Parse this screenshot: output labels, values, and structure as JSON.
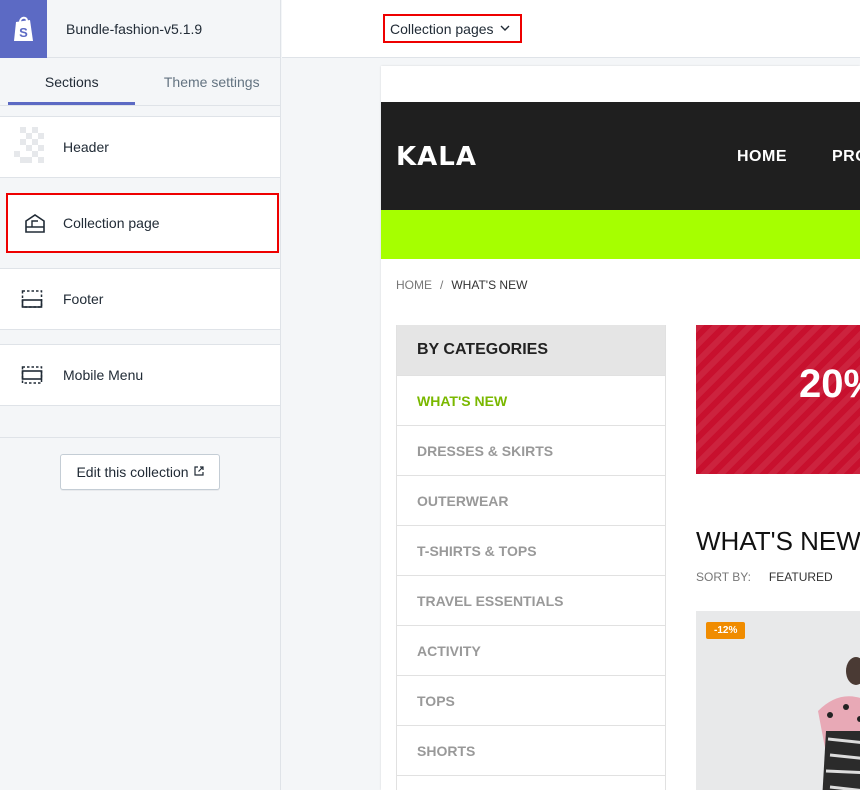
{
  "theme": {
    "name": "Bundle-fashion-v5.1.9",
    "logo_icon": "shopify-bag-icon",
    "accent": "#5c6ac4"
  },
  "tabs": {
    "sections": "Sections",
    "theme_settings": "Theme settings"
  },
  "sections": [
    {
      "label": "Header",
      "icon": "header-placeholder-icon"
    },
    {
      "label": "Collection page",
      "icon": "collection-template-icon",
      "highlighted": true
    },
    {
      "label": "Footer",
      "icon": "footer-layout-icon"
    },
    {
      "label": "Mobile Menu",
      "icon": "mobile-menu-layout-icon"
    }
  ],
  "edit_collection": {
    "label": "Edit this collection",
    "icon": "external-link-icon"
  },
  "page_selector": {
    "value": "Collection pages",
    "icon": "chevron-down-icon"
  },
  "store": {
    "logo": "KALA",
    "nav": [
      "HOME",
      "PRO"
    ],
    "colors": {
      "header_bg": "#1f1f1f",
      "banner": "#a6ff00",
      "active_category": "#7ab800",
      "promo": "#c8102e",
      "badge": "#f08c00"
    },
    "breadcrumb": {
      "home": "HOME",
      "separator": "/",
      "current": "WHAT'S NEW"
    },
    "categories": {
      "heading": "BY CATEGORIES",
      "items": [
        "WHAT'S NEW",
        "DRESSES & SKIRTS",
        "OUTERWEAR",
        "T-SHIRTS & TOPS",
        "TRAVEL ESSENTIALS",
        "ACTIVITY",
        "TOPS",
        "SHORTS"
      ],
      "active": "WHAT'S NEW"
    },
    "promo_text": "20%",
    "collection_title": "WHAT'S NEW",
    "sort": {
      "label": "SORT BY:",
      "value": "FEATURED"
    },
    "product_badge": "-12%"
  }
}
